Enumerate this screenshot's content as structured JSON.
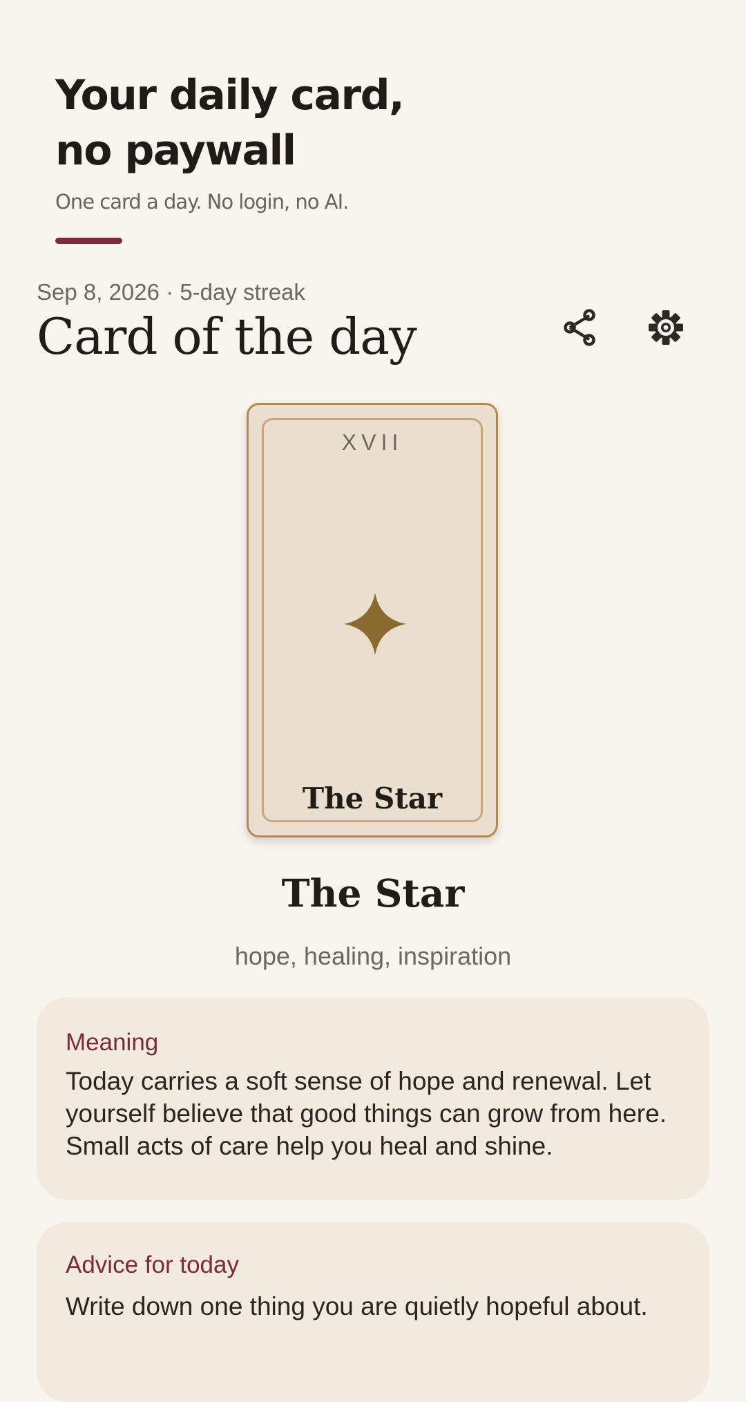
{
  "promo": {
    "headline": "Your daily card,\nno paywall",
    "subtitle": "One card a day. No login, no AI."
  },
  "header": {
    "date": "Sep 8, 2026",
    "separator": "·",
    "streak": "5-day streak",
    "meta_line": "Sep 8, 2026 · 5-day streak",
    "title": "Card of the day",
    "share_icon": "share-icon",
    "settings_icon": "gear-icon"
  },
  "card": {
    "numeral": "XVII",
    "symbol": "four-point-star-icon",
    "face_name": "The Star",
    "name": "The Star",
    "keywords": "hope, healing, inspiration"
  },
  "meaning": {
    "label": "Meaning",
    "text": "Today carries a soft sense of hope and renewal. Let yourself believe that good things can grow from here. Small acts of care help you heal and shine."
  },
  "advice": {
    "label": "Advice for today",
    "text": "Write down one thing you are quietly hopeful about."
  },
  "colors": {
    "background": "#f8f4ee",
    "accent": "#7a2d39",
    "card_gold": "#8a6a2e",
    "card_face": "#eadfce",
    "panel": "#f3eadf"
  }
}
